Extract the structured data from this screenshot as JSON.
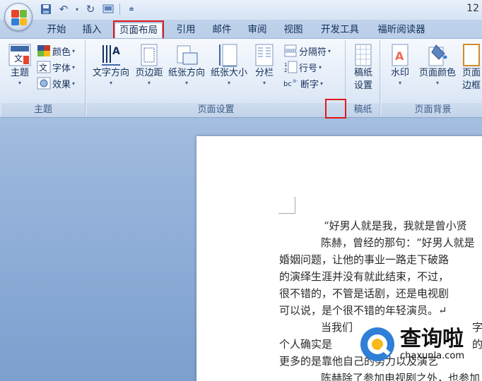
{
  "window": {
    "title_fragment": "12"
  },
  "tabs": [
    "开始",
    "插入",
    "页面布局",
    "引用",
    "邮件",
    "审阅",
    "视图",
    "开发工具",
    "福昕阅读器"
  ],
  "active_tab": "页面布局",
  "ribbon": {
    "theme_group": {
      "label": "主题",
      "theme_button": "主题",
      "colors": "颜色",
      "fonts": "字体",
      "effects": "效果"
    },
    "page_setup_group": {
      "label": "页面设置",
      "text_direction": "文字方向",
      "margins": "页边距",
      "orientation": "纸张方向",
      "size": "纸张大小",
      "columns": "分栏",
      "breaks": "分隔符",
      "line_numbers": "行号",
      "hyphenation": "断字"
    },
    "manuscript_group": {
      "label": "稿纸",
      "manuscript_settings_line1": "稿纸",
      "manuscript_settings_line2": "设置"
    },
    "page_background_group": {
      "label": "页面背景",
      "watermark": "水印",
      "page_color": "页面颜色",
      "page_borders_line1": "页面",
      "page_borders_line2": "边框"
    }
  },
  "document": {
    "lines": [
      "“好男人就是我，我就是曾小贤",
      "陈赫，曾经的那句：“好男人就是",
      "婚姻问题，让他的事业一路走下破路",
      "的演绎生涯并没有就此结束，不过，",
      "很不错的，不管是话剧，还是电视剧",
      "可以说，是个很不错的年轻演员。↵",
      "当我们",
      "个人确实是",
      "更多的是靠他自己的努力以及演艺",
      "陈赫除了参加电视剧之外，也参加"
    ],
    "line_fragments": [
      "字",
      "的"
    ]
  },
  "watermark": {
    "brand": "查询啦",
    "domain": "chaxunla.com"
  },
  "colors": {
    "highlight_box": "#e0191a",
    "ribbon_text": "#15305a",
    "office_red": "#e8432c",
    "office_green": "#6cbb3c",
    "office_blue": "#2f7fd6",
    "office_yellow": "#f7b91b"
  }
}
